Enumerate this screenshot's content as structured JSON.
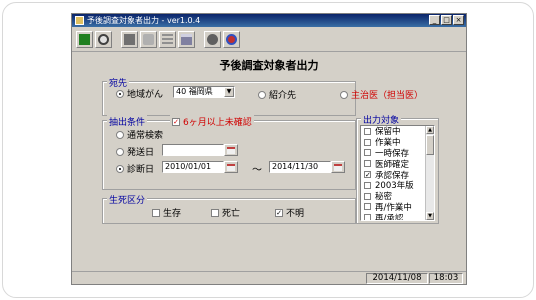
{
  "window": {
    "title": "予後調査対象者出力 - ver1.0.4"
  },
  "titlebar_buttons": [
    "_",
    "□",
    "×"
  ],
  "toolbar": {
    "buttons": [
      {
        "name": "exit-icon",
        "color": "#208020"
      },
      {
        "name": "search-icon",
        "color": "#404040"
      },
      {
        "name": "blank-icon",
        "color": "#707070"
      },
      {
        "name": "sync-icon",
        "color": "#909090"
      },
      {
        "name": "list-icon",
        "color": "#909090"
      },
      {
        "name": "save-icon",
        "color": "#8080a0"
      },
      {
        "name": "settings-icon",
        "color": "#606060"
      },
      {
        "name": "help-icon",
        "color": "#c03030"
      }
    ]
  },
  "heading": "予後調査対象者出力",
  "destination": {
    "label": "宛先",
    "options": [
      {
        "label": "地域がん",
        "selected": true
      },
      {
        "label": "紹介先",
        "selected": false
      },
      {
        "label": "主治医（担当医）",
        "selected": false
      }
    ],
    "region_select": "40 福岡県"
  },
  "extraction": {
    "label": "抽出条件",
    "six_month_check": "6ヶ月以上未確認",
    "six_month_checked": true,
    "options": [
      {
        "label": "通常検索",
        "selected": false
      },
      {
        "label": "発送日",
        "selected": false
      },
      {
        "label": "診断日",
        "selected": true
      }
    ],
    "send_date": "",
    "diag_from": "2010/01/01",
    "tilde": "～",
    "diag_to": "2014/11/30"
  },
  "vital": {
    "label": "生死区分",
    "options": [
      {
        "label": "生存",
        "checked": false
      },
      {
        "label": "死亡",
        "checked": false
      },
      {
        "label": "不明",
        "checked": true
      }
    ]
  },
  "output_target": {
    "label": "出力対象",
    "items": [
      {
        "label": "保留中",
        "checked": false
      },
      {
        "label": "作業中",
        "checked": false
      },
      {
        "label": "一時保存",
        "checked": false
      },
      {
        "label": "医師確定",
        "checked": false
      },
      {
        "label": "承認保存",
        "checked": true
      },
      {
        "label": "2003年版",
        "checked": false
      },
      {
        "label": "秘密",
        "checked": false
      },
      {
        "label": "再/作業中",
        "checked": false
      },
      {
        "label": "再/承認",
        "checked": false
      }
    ]
  },
  "status": {
    "date": "2014/11/08",
    "time": "18:03"
  }
}
